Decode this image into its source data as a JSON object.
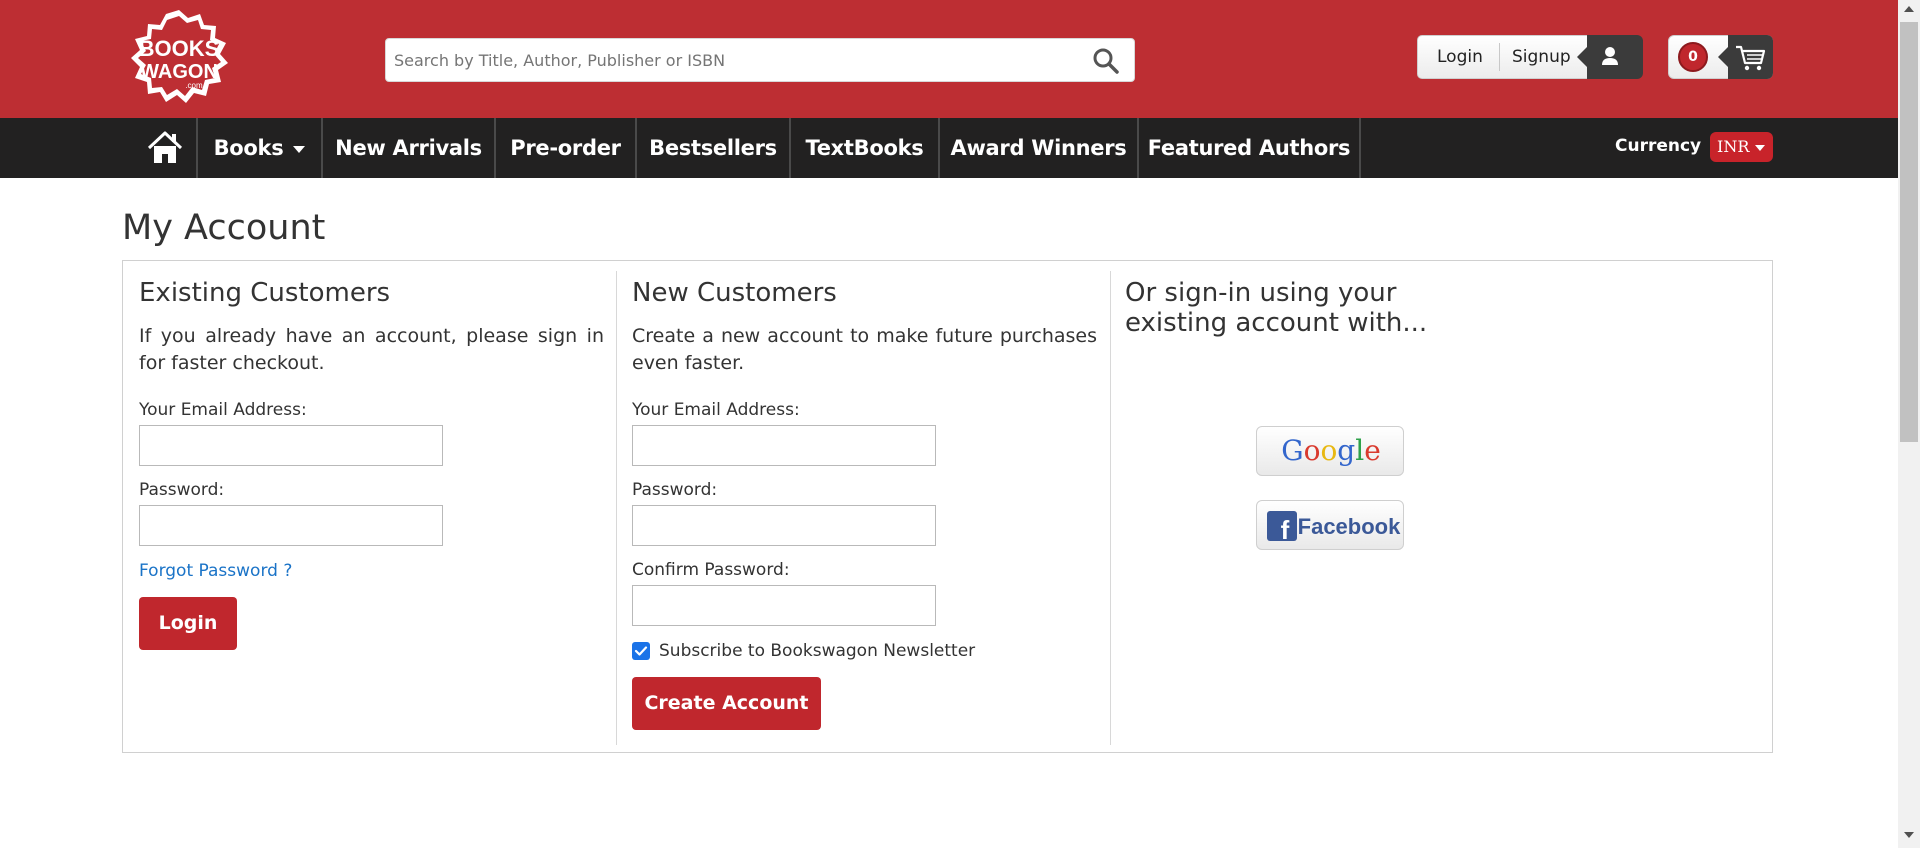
{
  "header": {
    "logo_alt": "BOOKSWAGON",
    "search_placeholder": "Search by Title, Author, Publisher or ISBN",
    "login_label": "Login",
    "signup_label": "Signup",
    "cart_count": "0"
  },
  "nav": {
    "items": [
      "Books",
      "New Arrivals",
      "Pre-order",
      "Bestsellers",
      "TextBooks",
      "Award Winners",
      "Featured Authors"
    ],
    "currency_label": "Currency",
    "currency_value": "INR"
  },
  "page": {
    "title": "My Account"
  },
  "existing": {
    "heading": "Existing Customers",
    "description": "If you already have an account, please sign in for faster checkout.",
    "email_label": "Your Email Address:",
    "password_label": "Password:",
    "forgot_label": "Forgot Password ?",
    "login_button": "Login"
  },
  "new_customers": {
    "heading": "New Customers",
    "description": "Create a new account to make future purchases even faster.",
    "email_label": "Your Email Address:",
    "password_label": "Password:",
    "confirm_label": "Confirm Password:",
    "newsletter_label": "Subscribe to Bookswagon Newsletter",
    "newsletter_checked": true,
    "create_button": "Create Account"
  },
  "social": {
    "heading": "Or sign-in using your existing account with...",
    "google_label": "Google",
    "facebook_label": "Facebook"
  },
  "colors": {
    "brand_red": "#bd2e33",
    "nav_dark": "#222121",
    "button_red": "#c0272d",
    "link_blue": "#1a73c7"
  }
}
